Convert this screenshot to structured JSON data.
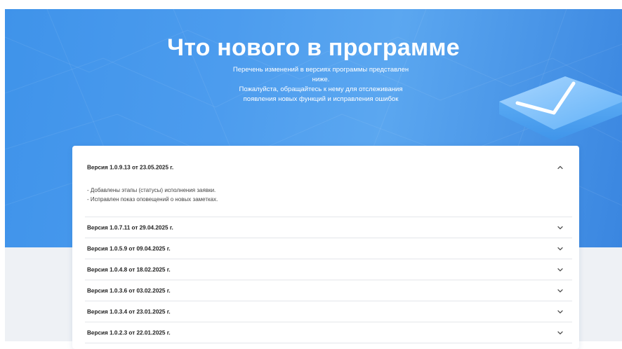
{
  "hero": {
    "title": "Что нового в программе",
    "subtitle_lines": [
      "Перечень изменений в версиях программы представлен",
      "ниже.",
      "Пожалуйста, обращайтесь к нему для отслеживания",
      "появления новых функций и исправления ошибок"
    ]
  },
  "versions": [
    {
      "title": "Версия 1.0.9.13 от 23.05.2025 г.",
      "expanded": true,
      "changes": [
        "- Добавлены этапы (статусы) исполнения заявки.",
        "- Исправлен показ оповещений о новых заметках."
      ]
    },
    {
      "title": "Версия 1.0.7.11 от 29.04.2025 г.",
      "expanded": false
    },
    {
      "title": "Версия 1.0.5.9 от 09.04.2025 г.",
      "expanded": false
    },
    {
      "title": "Версия 1.0.4.8 от 18.02.2025 г.",
      "expanded": false
    },
    {
      "title": "Версия 1.0.3.6 от 03.02.2025 г.",
      "expanded": false
    },
    {
      "title": "Версия 1.0.3.4 от 23.01.2025 г.",
      "expanded": false
    },
    {
      "title": "Версия 1.0.2.3 от 22.01.2025 г.",
      "expanded": false
    }
  ],
  "colors": {
    "hero_start": "#3f93ea",
    "hero_end": "#3a86e0",
    "page_background": "#eef1f5",
    "card_background": "#ffffff"
  },
  "icons": {
    "expanded": "chevron-up-icon",
    "collapsed": "chevron-down-icon",
    "decoration": "envelope-icon"
  }
}
